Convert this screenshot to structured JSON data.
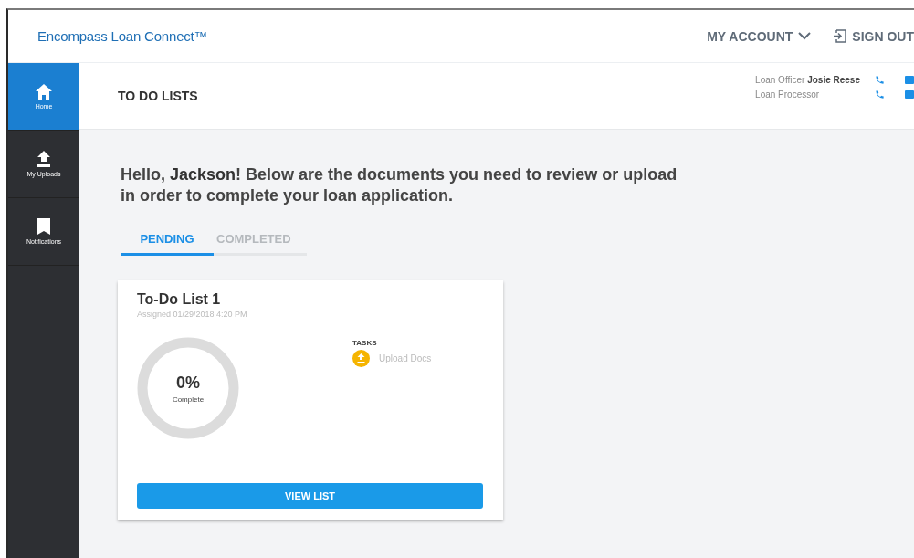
{
  "header": {
    "logo": "Encompass Loan Connect™",
    "account": "MY ACCOUNT",
    "sign_out": "SIGN OUT"
  },
  "sidebar": {
    "items": [
      {
        "label": "Home",
        "selected": true
      },
      {
        "label": "My Uploads",
        "selected": false
      },
      {
        "label": "Notifications",
        "selected": false
      }
    ]
  },
  "page_title": "TO DO LISTS",
  "contacts": [
    {
      "label": "Loan Officer **Josie Reese**"
    },
    {
      "label": "Loan Processor"
    }
  ],
  "greeting": "Hello, **Jackson**! Below are the documents you need to review or upload in order to complete your loan application.",
  "tabs": [
    {
      "label": "PENDING",
      "selected": true
    },
    {
      "label": "COMPLETED",
      "selected": false
    }
  ],
  "cards": [
    {
      "title": "To-Do List 1",
      "assigned": "Assigned 01/29/2018 4:20 PM",
      "percent": "0%",
      "percent_label": "Complete",
      "level": 0,
      "tasks_heading": "TASKS",
      "tasks": [
        {
          "label": "Upload Docs"
        }
      ],
      "button": "VIEW LIST"
    }
  ]
}
